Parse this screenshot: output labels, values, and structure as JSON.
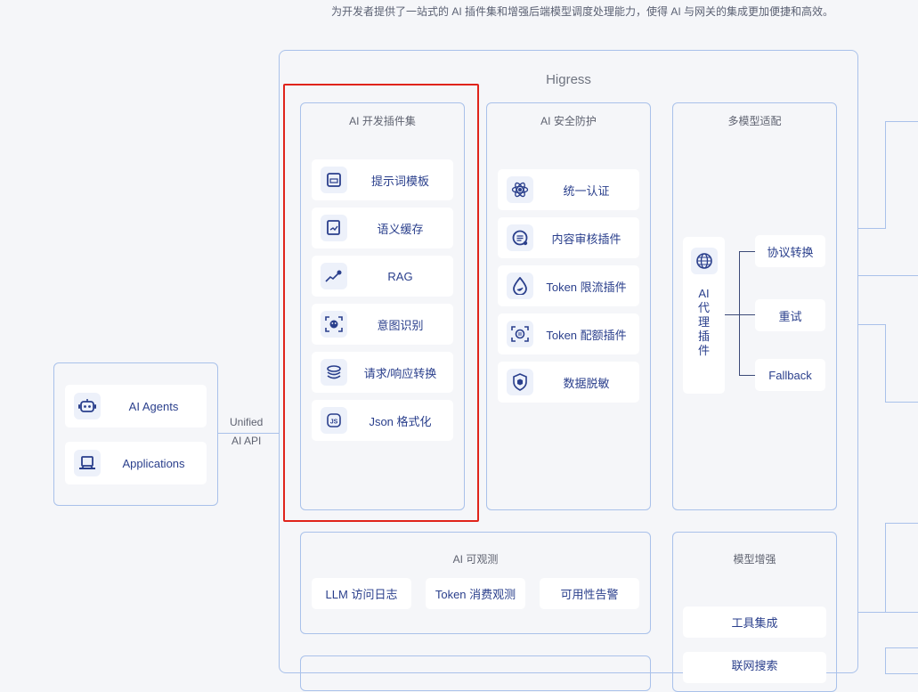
{
  "header": {
    "tagline": "为开发者提供了一站式的 AI 插件集和增强后端模型调度处理能力，使得 AI 与网关的集成更加便捷和高效。"
  },
  "clients": {
    "items": [
      {
        "label": "AI Agents",
        "icon": "robot-icon"
      },
      {
        "label": "Applications",
        "icon": "laptop-icon"
      }
    ],
    "connector_line1": "Unified",
    "connector_line2": "AI API"
  },
  "higress": {
    "title": "Higress"
  },
  "dev_plugins": {
    "title": "AI 开发插件集",
    "items": [
      {
        "label": "提示词模板",
        "icon": "template-icon"
      },
      {
        "label": "语义缓存",
        "icon": "cache-icon"
      },
      {
        "label": "RAG",
        "icon": "trend-icon"
      },
      {
        "label": "意图识别",
        "icon": "face-scan-icon"
      },
      {
        "label": "请求/响应转换",
        "icon": "transform-icon"
      },
      {
        "label": "Json 格式化",
        "icon": "js-icon"
      }
    ]
  },
  "security": {
    "title": "AI 安全防护",
    "items": [
      {
        "label": "统一认证",
        "icon": "auth-icon"
      },
      {
        "label": "内容审核插件",
        "icon": "review-icon"
      },
      {
        "label": "Token 限流插件",
        "icon": "drop-icon"
      },
      {
        "label": "Token 配额插件",
        "icon": "quota-icon"
      },
      {
        "label": "数据脱敏",
        "icon": "shield-icon"
      }
    ]
  },
  "multi_model": {
    "title": "多模型适配",
    "proxy_label": "AI\n代\n理\n插\n件",
    "branches": [
      "协议转换",
      "重试",
      "Fallback"
    ]
  },
  "observability": {
    "title": "AI 可观测",
    "items": [
      "LLM 访问日志",
      "Token 消费观测",
      "可用性告警"
    ]
  },
  "model_enhance": {
    "title": "模型增强",
    "items": [
      "工具集成",
      "联网搜索"
    ]
  },
  "colors": {
    "accent": "#2a3f8c",
    "panel_border": "#a9c1ea",
    "highlight": "#e0241b",
    "background": "#f5f6f9"
  }
}
